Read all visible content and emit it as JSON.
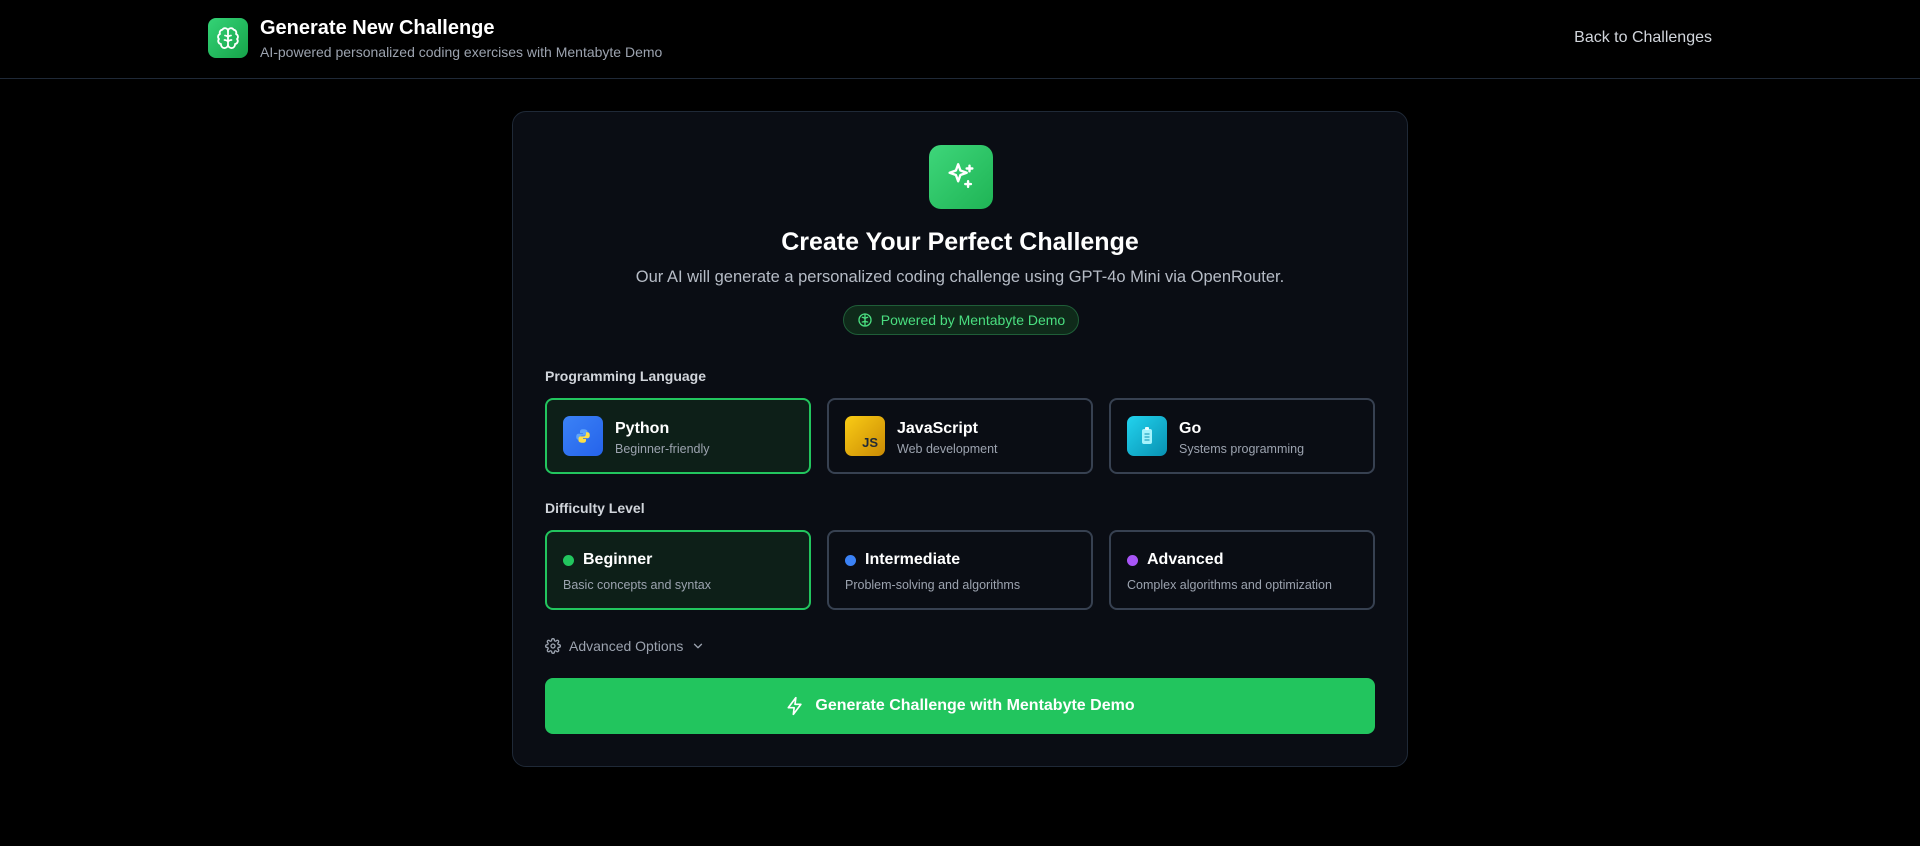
{
  "header": {
    "title": "Generate New Challenge",
    "subtitle": "AI-powered personalized coding exercises with Mentabyte Demo",
    "back_link": "Back to Challenges",
    "icon": "brain-icon"
  },
  "hero": {
    "icon": "sparkles-icon",
    "title": "Create Your Perfect Challenge",
    "subtitle": "Our AI will generate a personalized coding challenge using GPT-4o Mini via OpenRouter.",
    "badge": "Powered by Mentabyte Demo"
  },
  "language": {
    "label": "Programming Language",
    "selected": "Python",
    "options": [
      {
        "name": "Python",
        "desc": "Beginner-friendly",
        "icon": "python-icon",
        "color": "#3b82f6"
      },
      {
        "name": "JavaScript",
        "desc": "Web development",
        "icon": "JS",
        "color": "#eab308"
      },
      {
        "name": "Go",
        "desc": "Systems programming",
        "icon": "go-icon",
        "color": "#06b6d4"
      }
    ]
  },
  "difficulty": {
    "label": "Difficulty Level",
    "selected": "Beginner",
    "options": [
      {
        "name": "Beginner",
        "desc": "Basic concepts and syntax",
        "color": "#22c55e"
      },
      {
        "name": "Intermediate",
        "desc": "Problem-solving and algorithms",
        "color": "#3b82f6"
      },
      {
        "name": "Advanced",
        "desc": "Complex algorithms and optimization",
        "color": "#a855f7"
      }
    ]
  },
  "advanced_options": {
    "label": "Advanced Options"
  },
  "generate_button": {
    "label": "Generate Challenge with Mentabyte Demo"
  },
  "colors": {
    "accent": "#22c55e",
    "background": "#000000",
    "card": "#0a0d14"
  }
}
